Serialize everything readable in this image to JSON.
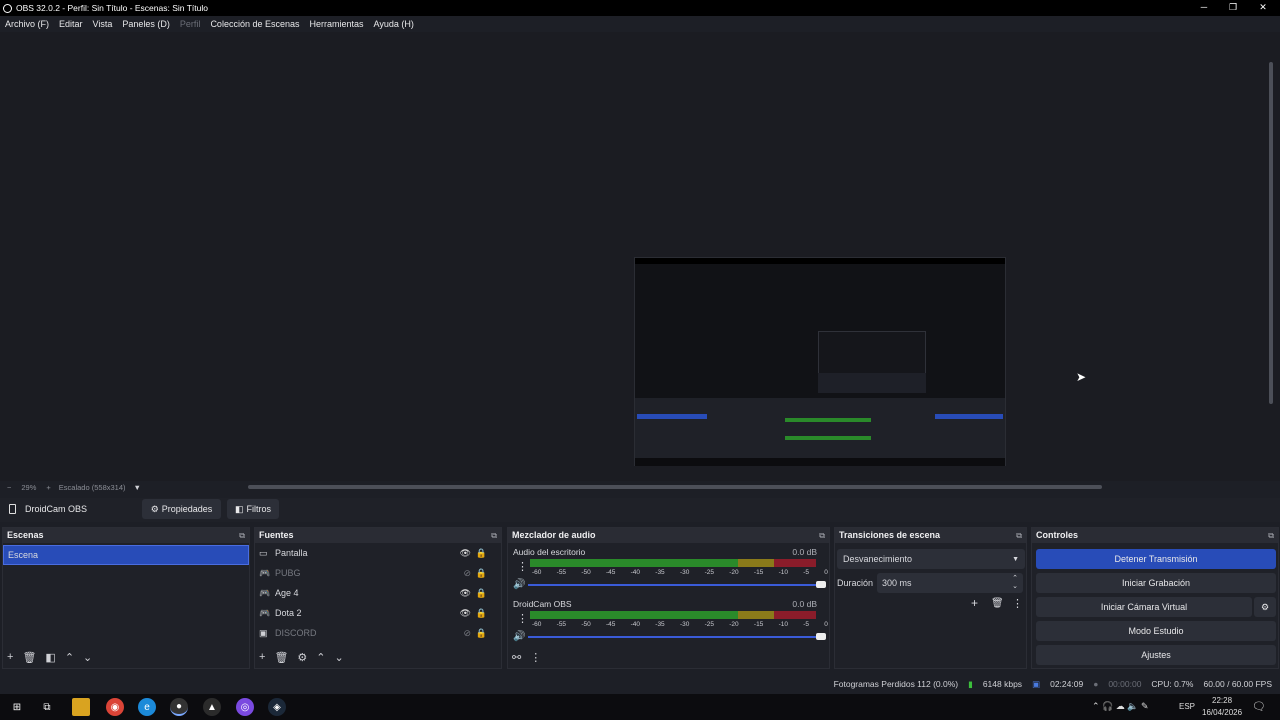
{
  "window": {
    "title": "OBS 32.0.2 - Perfil: Sin Título - Escenas: Sin Título"
  },
  "menu": [
    {
      "label": "Archivo (F)",
      "disabled": false
    },
    {
      "label": "Editar",
      "disabled": false
    },
    {
      "label": "Vista",
      "disabled": false
    },
    {
      "label": "Paneles (D)",
      "disabled": false
    },
    {
      "label": "Perfil",
      "disabled": true
    },
    {
      "label": "Colección de Escenas",
      "disabled": false
    },
    {
      "label": "Herramientas",
      "disabled": false
    },
    {
      "label": "Ayuda (H)",
      "disabled": false
    }
  ],
  "preview": {
    "zoom": "29%",
    "scaling": "Escalado (558x314)"
  },
  "source_toolbar": {
    "selected_source": "DroidCam OBS",
    "properties_label": "Propiedades",
    "filters_label": "Filtros"
  },
  "scenes": {
    "title": "Escenas",
    "items": [
      {
        "label": "Escena",
        "selected": true
      }
    ]
  },
  "sources": {
    "title": "Fuentes",
    "items": [
      {
        "label": "Pantalla",
        "icon": "monitor-icon",
        "visible": true
      },
      {
        "label": "PUBG",
        "icon": "gamepad-icon",
        "visible": false
      },
      {
        "label": "Age 4",
        "icon": "gamepad-icon",
        "visible": true
      },
      {
        "label": "Dota 2",
        "icon": "gamepad-icon",
        "visible": true
      },
      {
        "label": "DISCORD",
        "icon": "window-icon",
        "visible": false
      }
    ]
  },
  "mixer": {
    "title": "Mezclador de audio",
    "ticks": [
      "-60",
      "-55",
      "-50",
      "-45",
      "-40",
      "-35",
      "-30",
      "-25",
      "-20",
      "-15",
      "-10",
      "-5",
      "0"
    ],
    "channels": [
      {
        "name": "Audio del escritorio",
        "db": "0.0 dB"
      },
      {
        "name": "DroidCam OBS",
        "db": "0.0 dB"
      }
    ]
  },
  "transitions": {
    "title": "Transiciones de escena",
    "selected": "Desvanecimiento",
    "duration_label": "Duración",
    "duration_value": "300 ms"
  },
  "controls": {
    "title": "Controles",
    "stop_stream": "Detener Transmisión",
    "start_recording": "Iniciar Grabación",
    "start_virtual_cam": "Iniciar Cámara Virtual",
    "studio_mode": "Modo Estudio",
    "settings": "Ajustes"
  },
  "status": {
    "dropped_frames": "Fotogramas Perdidos 112 (0.0%)",
    "bitrate": "6148 kbps",
    "stream_time": "02:24:09",
    "record_time": "00:00:00",
    "cpu": "CPU: 0.7%",
    "fps": "60.00 / 60.00 FPS"
  },
  "taskbar": {
    "lang": "ESP",
    "time": "22:28",
    "date": "16/04/2026"
  },
  "colors": {
    "accent": "#284cb8",
    "meter_green": "#2a8a2a",
    "meter_yellow": "#8a7a1a",
    "meter_red": "#8a1c2a"
  }
}
